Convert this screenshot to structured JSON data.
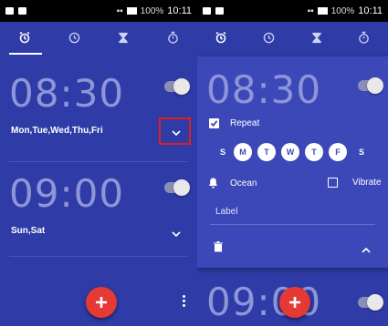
{
  "status": {
    "battery": "100%",
    "time": "10:11"
  },
  "tabs": [
    {
      "name": "alarm",
      "icon": "alarm-icon"
    },
    {
      "name": "clock",
      "icon": "clock-icon"
    },
    {
      "name": "timer",
      "icon": "hourglass-icon"
    },
    {
      "name": "stopwatch",
      "icon": "stopwatch-icon"
    }
  ],
  "left": {
    "alarms": [
      {
        "time": "08:30",
        "days": "Mon,Tue,Wed,Thu,Fri",
        "enabled": false
      },
      {
        "time": "09:00",
        "days": "Sun,Sat",
        "enabled": false
      }
    ]
  },
  "right": {
    "alarm": {
      "time": "08:30",
      "enabled": false
    },
    "repeat_label": "Repeat",
    "days": [
      {
        "letter": "S",
        "on": false
      },
      {
        "letter": "M",
        "on": true
      },
      {
        "letter": "T",
        "on": true
      },
      {
        "letter": "W",
        "on": true
      },
      {
        "letter": "T",
        "on": true
      },
      {
        "letter": "F",
        "on": true
      },
      {
        "letter": "S",
        "on": false
      }
    ],
    "ringtone": "Ocean",
    "vibrate_label": "Vibrate",
    "label_label": "Label",
    "next_time": "09:00"
  },
  "colors": {
    "background": "#2f3ba6",
    "card": "#3c48b8",
    "fab": "#e53935",
    "highlight": "#e02020"
  }
}
